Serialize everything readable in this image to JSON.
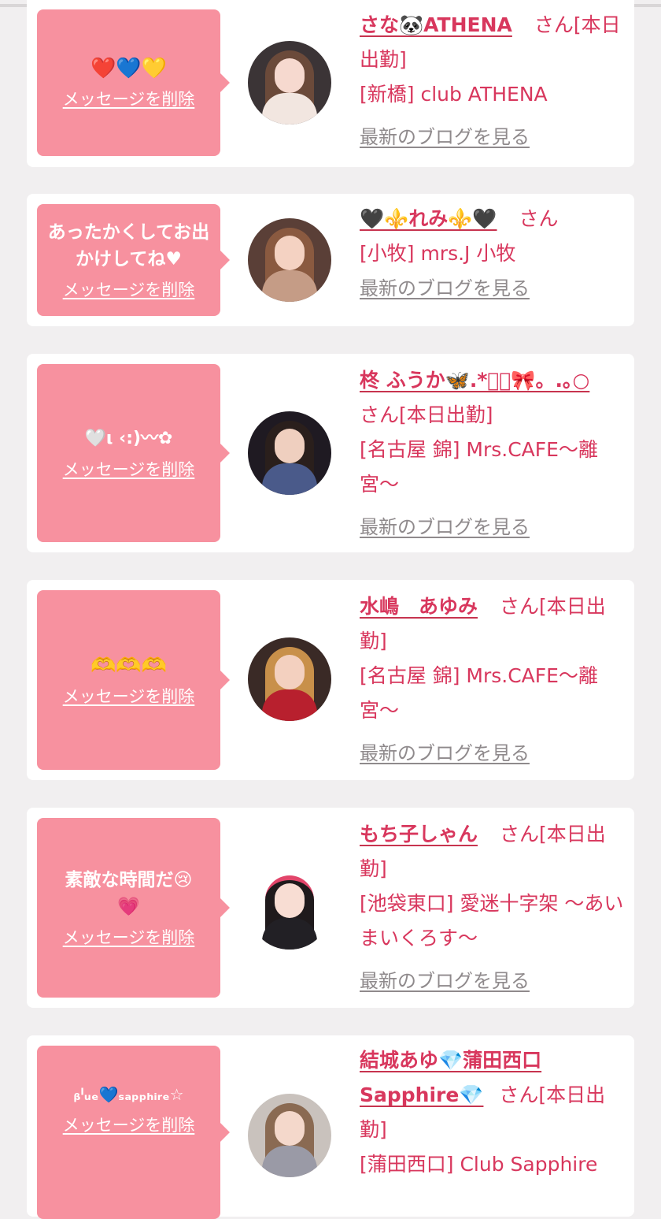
{
  "delete_label": "メッセージを削除",
  "blog_label": "最新のブログを見る",
  "san_label": "さん",
  "colors": {
    "bubble": "#f7919f",
    "accent": "#d8375d",
    "muted": "#8f8a8c",
    "background": "#f1eff0"
  },
  "cards": [
    {
      "message": "❤️💙💛",
      "name": "さな🐼ATHENA",
      "suffix": "[本日出勤]",
      "shop": "[新橋] club ATHENA"
    },
    {
      "message": "あったかくしてお出かけしてね♥",
      "name": "🖤⚜️れみ⚜️🖤",
      "suffix": "",
      "shop": "[小牧] mrs.J 小牧"
    },
    {
      "message": "🤍ι ‹:)〰✿",
      "name": "柊 ふうか🦋.*゚︶🎀。.｡○",
      "suffix": "[本日出勤]",
      "shop": "[名古屋 錦] Mrs.CAFE〜離宮〜"
    },
    {
      "message": "🫶🫶🫶",
      "name": "水嶋　あゆみ",
      "suffix": "[本日出勤]",
      "shop": "[名古屋 錦] Mrs.CAFE〜離宮〜"
    },
    {
      "message": "素敵な時間だ😢💗",
      "name": "もち子しゃん",
      "suffix": "[本日出勤]",
      "shop": "[池袋東口] 愛迷十字架 〜あいまいくろす〜"
    },
    {
      "message": "ᵦˡᵤₑ💙ₛₐₚₚₕᵢᵣₑ☆",
      "name": "結城あゆ💎蒲田西口Sapphire💎",
      "suffix": "[本日出勤]",
      "shop": "[蒲田西口] Club Sapphire"
    }
  ]
}
